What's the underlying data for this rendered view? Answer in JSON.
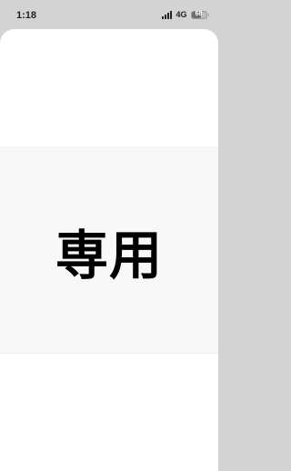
{
  "status_bar": {
    "time": "1:18",
    "network": "4G",
    "battery_level": "68",
    "signal_icon": "cellular-signal-icon",
    "battery_icon": "battery-icon"
  },
  "banner": {
    "text": "専用"
  },
  "colors": {
    "status_background": "#d3d3d3",
    "sheet_background": "#ffffff",
    "banner_background": "#f8f8f8",
    "text": "#000000"
  }
}
